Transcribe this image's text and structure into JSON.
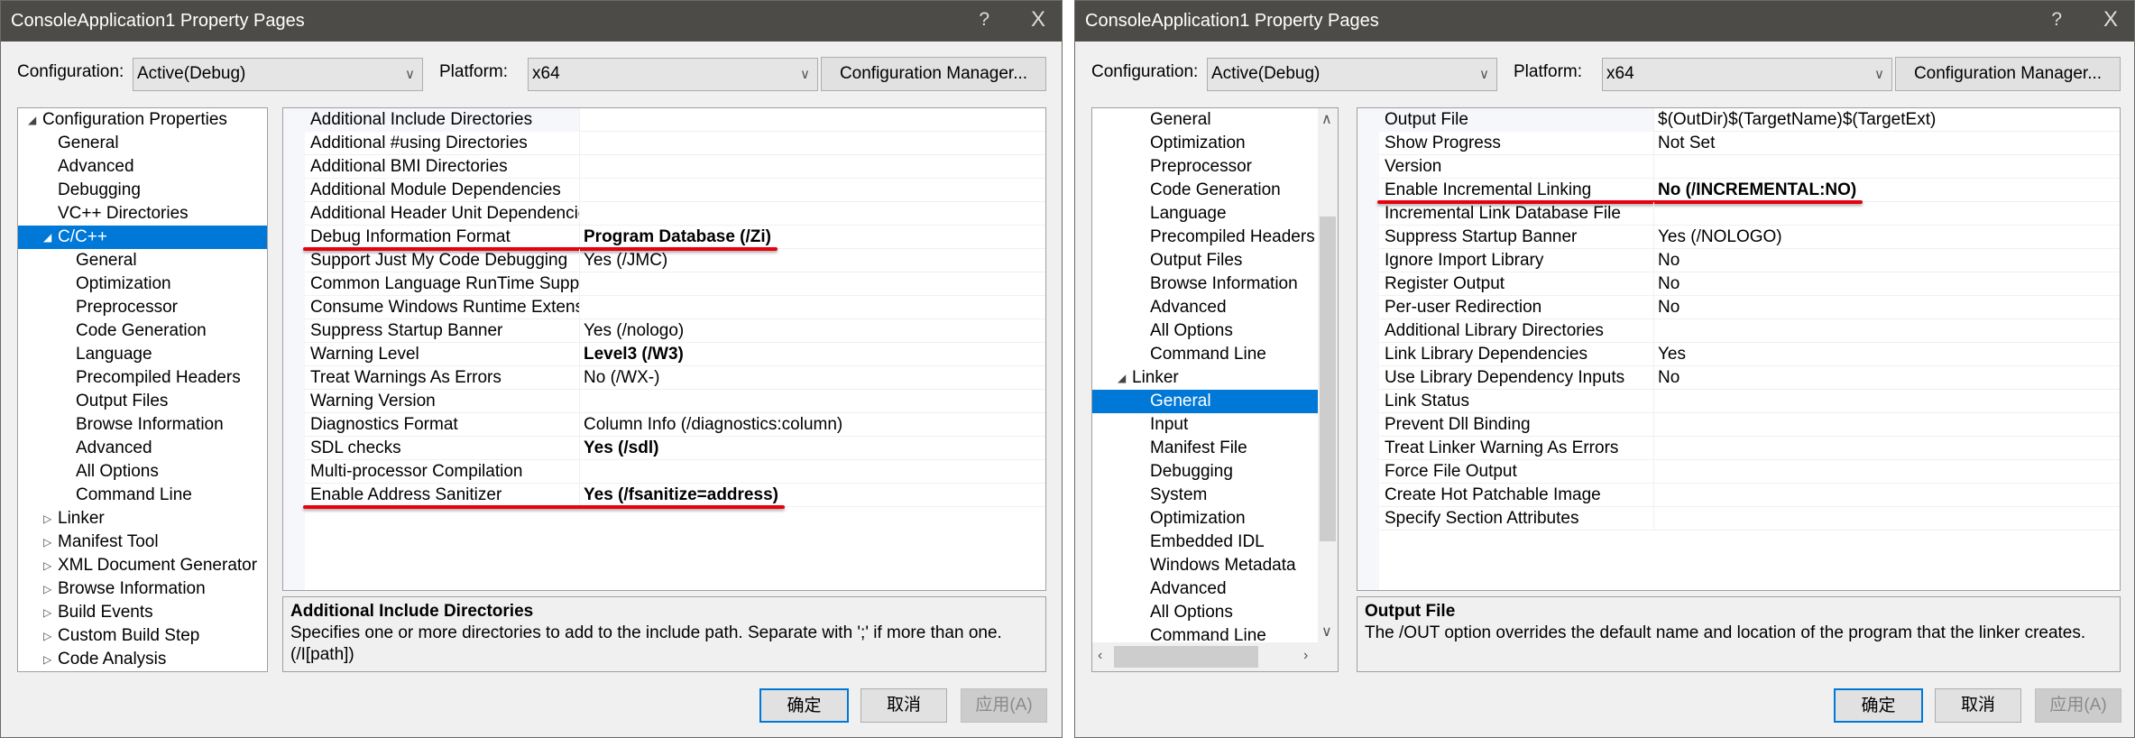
{
  "colors": {
    "selection": "#0078d7",
    "titlebar": "#4d4b48",
    "annotation_underline": "#e8000c"
  },
  "dialogs": [
    {
      "title": "ConsoleApplication1 Property Pages",
      "help_label": "?",
      "close_label": "X",
      "config_label": "Configuration:",
      "config_value": "Active(Debug)",
      "platform_label": "Platform:",
      "platform_value": "x64",
      "config_manager_label": "Configuration Manager...",
      "tree_scrollbars": false,
      "tree": [
        {
          "label": "Configuration Properties",
          "level": 0,
          "expander": "expanded"
        },
        {
          "label": "General",
          "level": 1
        },
        {
          "label": "Advanced",
          "level": 1
        },
        {
          "label": "Debugging",
          "level": 1
        },
        {
          "label": "VC++ Directories",
          "level": 1
        },
        {
          "label": "C/C++",
          "level": 1,
          "expander": "expanded",
          "selected": true
        },
        {
          "label": "General",
          "level": 2
        },
        {
          "label": "Optimization",
          "level": 2
        },
        {
          "label": "Preprocessor",
          "level": 2
        },
        {
          "label": "Code Generation",
          "level": 2
        },
        {
          "label": "Language",
          "level": 2
        },
        {
          "label": "Precompiled Headers",
          "level": 2
        },
        {
          "label": "Output Files",
          "level": 2
        },
        {
          "label": "Browse Information",
          "level": 2
        },
        {
          "label": "Advanced",
          "level": 2
        },
        {
          "label": "All Options",
          "level": 2
        },
        {
          "label": "Command Line",
          "level": 2
        },
        {
          "label": "Linker",
          "level": 1,
          "expander": "collapsed"
        },
        {
          "label": "Manifest Tool",
          "level": 1,
          "expander": "collapsed"
        },
        {
          "label": "XML Document Generator",
          "level": 1,
          "expander": "collapsed"
        },
        {
          "label": "Browse Information",
          "level": 1,
          "expander": "collapsed"
        },
        {
          "label": "Build Events",
          "level": 1,
          "expander": "collapsed"
        },
        {
          "label": "Custom Build Step",
          "level": 1,
          "expander": "collapsed"
        },
        {
          "label": "Code Analysis",
          "level": 1,
          "expander": "collapsed"
        }
      ],
      "grid": [
        {
          "name": "Additional Include Directories",
          "value": ""
        },
        {
          "name": "Additional #using Directories",
          "value": ""
        },
        {
          "name": "Additional BMI Directories",
          "value": ""
        },
        {
          "name": "Additional Module Dependencies",
          "value": ""
        },
        {
          "name": "Additional Header Unit Dependencies",
          "value": ""
        },
        {
          "name": "Debug Information Format",
          "value": "Program Database (/Zi)",
          "bold": true,
          "underlined": true
        },
        {
          "name": "Support Just My Code Debugging",
          "value": "Yes (/JMC)"
        },
        {
          "name": "Common Language RunTime Support",
          "value": ""
        },
        {
          "name": "Consume Windows Runtime Extension",
          "value": ""
        },
        {
          "name": "Suppress Startup Banner",
          "value": "Yes (/nologo)"
        },
        {
          "name": "Warning Level",
          "value": "Level3 (/W3)",
          "bold": true
        },
        {
          "name": "Treat Warnings As Errors",
          "value": "No (/WX-)"
        },
        {
          "name": "Warning Version",
          "value": ""
        },
        {
          "name": "Diagnostics Format",
          "value": "Column Info (/diagnostics:column)"
        },
        {
          "name": "SDL checks",
          "value": "Yes (/sdl)",
          "bold": true
        },
        {
          "name": "Multi-processor Compilation",
          "value": ""
        },
        {
          "name": "Enable Address Sanitizer",
          "value": "Yes (/fsanitize=address)",
          "bold": true,
          "underlined": true
        }
      ],
      "description": {
        "title": "Additional Include Directories",
        "text": "Specifies one or more directories to add to the include path. Separate with ';' if more than one. (/I[path])"
      },
      "buttons": {
        "ok": "确定",
        "cancel": "取消",
        "apply": "应用(A)"
      }
    },
    {
      "title": "ConsoleApplication1 Property Pages",
      "help_label": "?",
      "close_label": "X",
      "config_label": "Configuration:",
      "config_value": "Active(Debug)",
      "platform_label": "Platform:",
      "platform_value": "x64",
      "config_manager_label": "Configuration Manager...",
      "tree_scrollbars": true,
      "tree": [
        {
          "label": "General",
          "level": 2
        },
        {
          "label": "Optimization",
          "level": 2
        },
        {
          "label": "Preprocessor",
          "level": 2
        },
        {
          "label": "Code Generation",
          "level": 2
        },
        {
          "label": "Language",
          "level": 2
        },
        {
          "label": "Precompiled Headers",
          "level": 2
        },
        {
          "label": "Output Files",
          "level": 2
        },
        {
          "label": "Browse Information",
          "level": 2
        },
        {
          "label": "Advanced",
          "level": 2
        },
        {
          "label": "All Options",
          "level": 2
        },
        {
          "label": "Command Line",
          "level": 2
        },
        {
          "label": "Linker",
          "level": 1,
          "expander": "expanded"
        },
        {
          "label": "General",
          "level": 2,
          "selected": true
        },
        {
          "label": "Input",
          "level": 2
        },
        {
          "label": "Manifest File",
          "level": 2
        },
        {
          "label": "Debugging",
          "level": 2
        },
        {
          "label": "System",
          "level": 2
        },
        {
          "label": "Optimization",
          "level": 2
        },
        {
          "label": "Embedded IDL",
          "level": 2
        },
        {
          "label": "Windows Metadata",
          "level": 2
        },
        {
          "label": "Advanced",
          "level": 2
        },
        {
          "label": "All Options",
          "level": 2
        },
        {
          "label": "Command Line",
          "level": 2
        }
      ],
      "grid": [
        {
          "name": "Output File",
          "value": "$(OutDir)$(TargetName)$(TargetExt)"
        },
        {
          "name": "Show Progress",
          "value": "Not Set"
        },
        {
          "name": "Version",
          "value": ""
        },
        {
          "name": "Enable Incremental Linking",
          "value": "No (/INCREMENTAL:NO)",
          "bold": true,
          "underlined": true
        },
        {
          "name": "Incremental Link Database File",
          "value": ""
        },
        {
          "name": "Suppress Startup Banner",
          "value": "Yes (/NOLOGO)"
        },
        {
          "name": "Ignore Import Library",
          "value": "No"
        },
        {
          "name": "Register Output",
          "value": "No"
        },
        {
          "name": "Per-user Redirection",
          "value": "No"
        },
        {
          "name": "Additional Library Directories",
          "value": ""
        },
        {
          "name": "Link Library Dependencies",
          "value": "Yes"
        },
        {
          "name": "Use Library Dependency Inputs",
          "value": "No"
        },
        {
          "name": "Link Status",
          "value": ""
        },
        {
          "name": "Prevent Dll Binding",
          "value": ""
        },
        {
          "name": "Treat Linker Warning As Errors",
          "value": ""
        },
        {
          "name": "Force File Output",
          "value": ""
        },
        {
          "name": "Create Hot Patchable Image",
          "value": ""
        },
        {
          "name": "Specify Section Attributes",
          "value": ""
        }
      ],
      "description": {
        "title": "Output File",
        "text": "The /OUT option overrides the default name and location of the program that the linker creates."
      },
      "buttons": {
        "ok": "确定",
        "cancel": "取消",
        "apply": "应用(A)"
      }
    }
  ]
}
